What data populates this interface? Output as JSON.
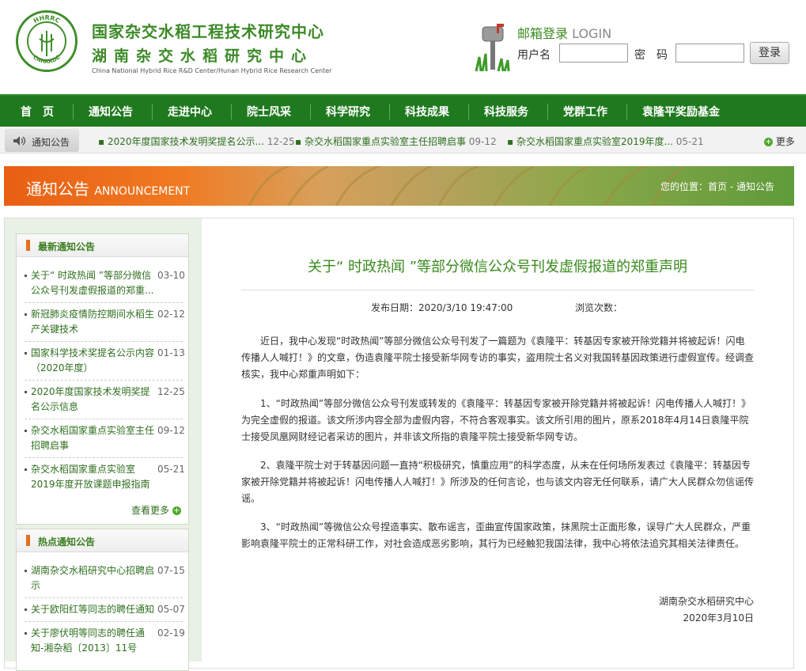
{
  "header": {
    "logo_top": "HHRRC",
    "logo_bottom": "CNHRRDC",
    "title_cn_1": "国家杂交水稻工程技术研究中心",
    "title_cn_2": "湖南杂交水稻研究中心",
    "title_en": "China National Hybrid Rice R&D Center/Hunan Hybrid Rice Research Center"
  },
  "login": {
    "title": "邮箱登录",
    "title_en": "LOGIN",
    "username_label": "用户名",
    "password_label": "密　码",
    "username_value": "",
    "password_value": "",
    "button_label": "登录"
  },
  "nav": {
    "items": [
      "首　页",
      "通知公告",
      "走进中心",
      "院士风采",
      "科学研究",
      "科技成果",
      "科技服务",
      "党群工作",
      "袁隆平奖励基金"
    ]
  },
  "ticker": {
    "label": "通知公告",
    "items": [
      {
        "title": "2020年度国家技术发明奖提名公示...",
        "date": "12-25"
      },
      {
        "title": "杂交水稻国家重点实验室主任招聘启事",
        "date": "09-12"
      },
      {
        "title": "杂交水稻国家重点实验室2019年度...",
        "date": "05-21"
      }
    ],
    "more": "更多"
  },
  "banner": {
    "title": "通知公告",
    "title_en": "ANNOUNCEMENT",
    "location_label": "您的位置：",
    "location_path": "首页 - 通知公告"
  },
  "sidebar": {
    "latest": {
      "heading": "最新通知公告",
      "items": [
        {
          "title": "关于“ 时政热闻 ”等部分微信公众号刊发虚假报道的郑重...",
          "date": "03-10"
        },
        {
          "title": "新冠肺炎疫情防控期间水稻生产关键技术",
          "date": "02-12"
        },
        {
          "title": "国家科学技术奖提名公示内容（2020年度）",
          "date": "01-13"
        },
        {
          "title": "2020年度国家技术发明奖提名公示信息",
          "date": "12-25"
        },
        {
          "title": "杂交水稻国家重点实验室主任招聘启事",
          "date": "09-12"
        },
        {
          "title": "杂交水稻国家重点实验室2019年度开放课题申报指南",
          "date": "05-21"
        }
      ],
      "more": "查看更多"
    },
    "hot": {
      "heading": "热点通知公告",
      "items": [
        {
          "title": "湖南杂交水稻研究中心招聘启示",
          "date": "07-15"
        },
        {
          "title": "关于欧阳红等同志的聘任通知",
          "date": "05-07"
        },
        {
          "title": "关于廖伏明等同志的聘任通知-湘杂稻〔2013〕11号",
          "date": "02-19"
        }
      ]
    }
  },
  "article": {
    "title": "关于“ 时政热闻 ”等部分微信公众号刊发虚假报道的郑重声明",
    "publish_label": "发布日期：",
    "publish_date": "2020/3/10 19:47:00",
    "views_label": "浏览次数：",
    "paragraphs": [
      "近日，我中心发现“时政热闻”等部分微信公众号刊发了一篇题为《袁隆平：转基因专家被开除党籍并将被起诉！闪电传播人人喊打！》的文章，伪造袁隆平院士接受新华网专访的事实，盗用院士名义对我国转基因政策进行虚假宣传。经调查核实，我中心郑重声明如下：",
      "1、“时政热闻”等部分微信公众号刊发或转发的《袁隆平：转基因专家被开除党籍并将被起诉！闪电传播人人喊打！》为完全虚假的报道。该文所涉内容全部为虚假内容，不符合客观事实。该文所引用的图片，原系2018年4月14日袁隆平院士接受凤凰网财经记者采访的图片，并非该文所指的袁隆平院士接受新华网专访。",
      "2、袁隆平院士对于转基因问题一直持“积极研究，慎重应用”的科学态度，从未在任何场所发表过《袁隆平：转基因专家被开除党籍并将被起诉！闪电传播人人喊打！》所涉及的任何言论，也与该文内容无任何联系，请广大人民群众勿信谣传谣。",
      "3、“时政热闻”等微信公众号捏造事实、散布谣言，歪曲宣传国家政策，抹黑院士正面形象，误导广大人民群众，严重影响袁隆平院士的正常科研工作，对社会造成恶劣影响，其行为已经触犯我国法律，我中心将依法追究其相关法律责任。"
    ],
    "signature_org": "湖南杂交水稻研究中心",
    "signature_date": "2020年3月10日"
  }
}
